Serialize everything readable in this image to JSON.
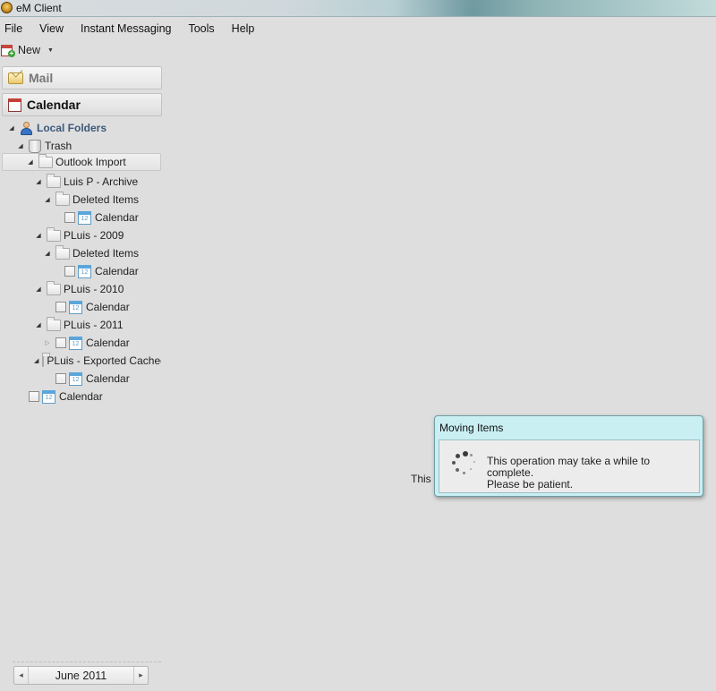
{
  "window": {
    "title": "eM Client"
  },
  "menu": [
    "File",
    "View",
    "Instant Messaging",
    "Tools",
    "Help"
  ],
  "toolbar": {
    "new_label": "New"
  },
  "sidebar": {
    "sections": {
      "mail": "Mail",
      "calendar": "Calendar"
    },
    "tree": [
      "Local Folders",
      "Trash",
      "Outlook Import",
      "Luis P - Archive",
      "Deleted Items",
      "Calendar",
      "PLuis - 2009",
      "Deleted Items",
      "Calendar",
      "PLuis - 2010",
      "Calendar",
      "PLuis - 2011",
      "Calendar",
      "PLuis - Exported Cached",
      "Calendar",
      "Calendar"
    ],
    "month_nav": {
      "label": "June 2011",
      "prev": "◂",
      "next": "▸"
    }
  },
  "main": {
    "background_text": "This f"
  },
  "dialog": {
    "title": "Moving Items",
    "message_line1": "This operation may take a while to complete.",
    "message_line2": "Please be patient."
  }
}
